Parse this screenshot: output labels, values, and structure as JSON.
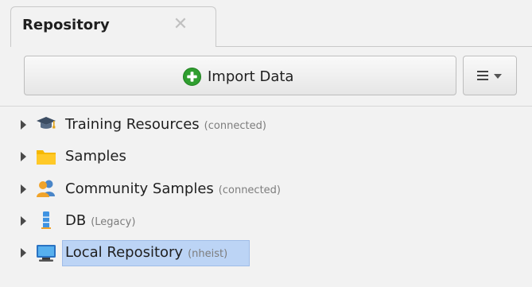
{
  "colors": {
    "background": "#f2f2f2",
    "selection": "#bcd4f5",
    "import_icon": "#2f9e2f"
  },
  "tab": {
    "title": "Repository",
    "close_icon": "close-icon"
  },
  "toolbar": {
    "import_label": "Import Data",
    "import_icon": "plus-circle-icon",
    "menu_icon": "hamburger-icon"
  },
  "repository": {
    "items": [
      {
        "label": "Training Resources",
        "status": "(connected)",
        "icon": "graduation-cap-icon",
        "expanded": false,
        "selected": false
      },
      {
        "label": "Samples",
        "status": "",
        "icon": "folder-icon",
        "expanded": false,
        "selected": false
      },
      {
        "label": "Community Samples",
        "status": "(connected)",
        "icon": "users-icon",
        "expanded": false,
        "selected": false
      },
      {
        "label": "DB",
        "status": "(Legacy)",
        "icon": "database-icon",
        "expanded": false,
        "selected": false
      },
      {
        "label": "Local Repository",
        "status": "(nheist)",
        "icon": "monitor-icon",
        "expanded": false,
        "selected": true
      }
    ]
  }
}
